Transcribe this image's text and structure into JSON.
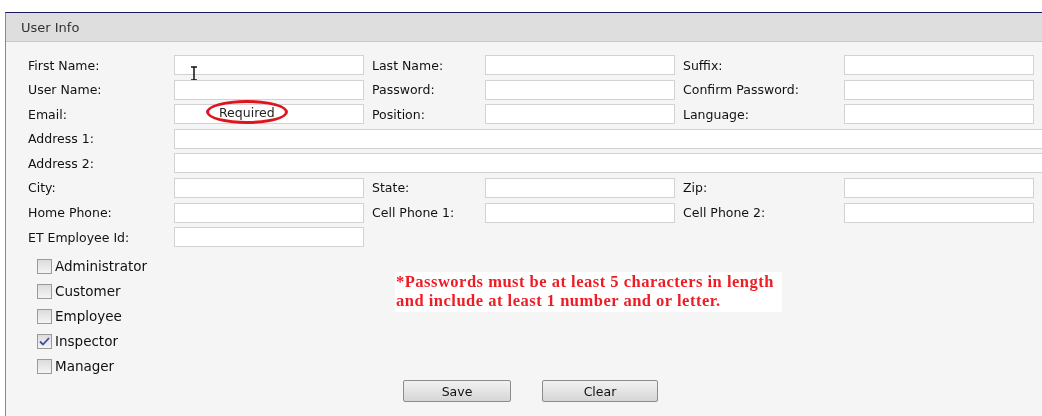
{
  "panel": {
    "title": "User Info"
  },
  "rows": [
    [
      {
        "label": "First Name:",
        "kind": "normal",
        "cursor": true
      },
      {
        "label": "Last Name:",
        "kind": "normal"
      },
      {
        "label": "Suffix:",
        "kind": "normal"
      }
    ],
    [
      {
        "label": "User Name:",
        "kind": "normal"
      },
      {
        "label": "Password:",
        "kind": "normal"
      },
      {
        "label": "Confirm Password:",
        "kind": "normal"
      }
    ],
    [
      {
        "label": "Email:",
        "kind": "normal",
        "validation": "Required"
      },
      {
        "label": "Position:",
        "kind": "normal"
      },
      {
        "label": "Language:",
        "kind": "normal"
      }
    ],
    [
      {
        "label": "Address 1:",
        "kind": "wide"
      }
    ],
    [
      {
        "label": "Address 2:",
        "kind": "wide"
      }
    ],
    [
      {
        "label": "City:",
        "kind": "normal"
      },
      {
        "label": "State:",
        "kind": "normal"
      },
      {
        "label": "Zip:",
        "kind": "normal"
      }
    ],
    [
      {
        "label": "Home Phone:",
        "kind": "normal"
      },
      {
        "label": "Cell Phone 1:",
        "kind": "normal"
      },
      {
        "label": "Cell Phone 2:",
        "kind": "normal"
      }
    ],
    [
      {
        "label": "ET Employee Id:",
        "kind": "normal"
      }
    ]
  ],
  "checkboxes": [
    {
      "label": "Administrator",
      "checked": false
    },
    {
      "label": "Customer",
      "checked": false
    },
    {
      "label": "Employee",
      "checked": false
    },
    {
      "label": "Inspector",
      "checked": true
    },
    {
      "label": "Manager",
      "checked": false
    }
  ],
  "note": [
    "*Passwords must be at least 5 characters in length",
    "and include at least 1 number and or letter."
  ],
  "buttons": [
    "Save",
    "Clear"
  ]
}
